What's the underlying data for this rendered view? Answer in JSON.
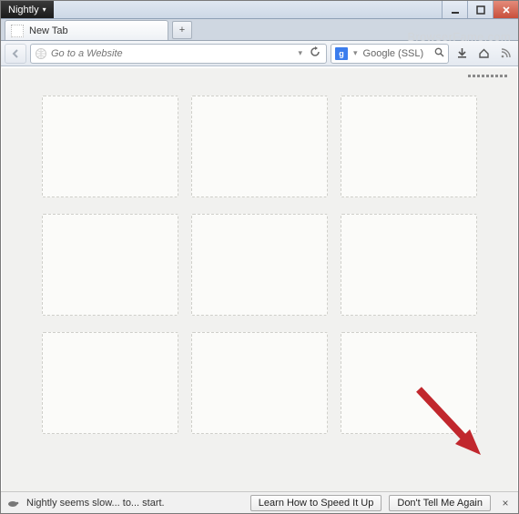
{
  "app": {
    "menu_label": "Nightly"
  },
  "watermark": "BrowserFame.com",
  "tabs": [
    {
      "label": "New Tab"
    }
  ],
  "newtab_plus": "+",
  "urlbar": {
    "placeholder": "Go to a Website"
  },
  "searchbar": {
    "engine_letter": "g",
    "label": "Google (SSL)"
  },
  "tiles_count": 9,
  "notification": {
    "message": "Nightly seems slow... to... start.",
    "learn_label": "Learn How to Speed It Up",
    "dismiss_label": "Don't Tell Me Again"
  }
}
